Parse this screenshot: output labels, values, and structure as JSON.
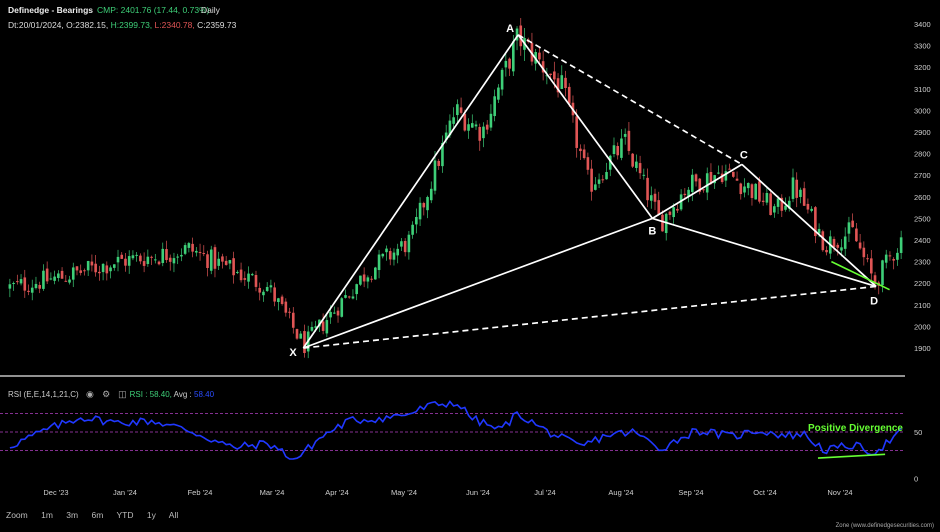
{
  "header": {
    "symbol": "Definedge - Bearings",
    "cmp": "CMP: 2401.76 (17.44, 0.73%)",
    "timeframe": "Daily",
    "date": "Dt:20/01/2024,",
    "open": "O:2382.15,",
    "high": "H:2399.73,",
    "low": "L:2340.78,",
    "close": "C:2359.73"
  },
  "rsi_panel": {
    "label": "RSI (E,E,14,1,21,C)",
    "value": "RSI : 58.40,",
    "avg_label": "Avg :",
    "avg_value": "58.40"
  },
  "zoom": {
    "label": "Zoom",
    "options": [
      "1m",
      "3m",
      "6m",
      "YTD",
      "1y",
      "All"
    ]
  },
  "credit": "Zone (www.definedgesecurities.com)",
  "colors": {
    "up": "#3ecf78",
    "down": "#e05555",
    "rsi_line": "#2038ff",
    "band": "#b040c0",
    "pattern": "#ffffff",
    "divergence": "#66ff33"
  },
  "chart_data": [
    {
      "type": "candlestick",
      "ylim": [
        1800,
        3450
      ],
      "yticks": [
        1900,
        2000,
        2100,
        2200,
        2300,
        2400,
        2500,
        2600,
        2700,
        2800,
        2900,
        3000,
        3100,
        3200,
        3300,
        3400
      ],
      "xticks": [
        "Dec '23",
        "Jan '24",
        "Feb '24",
        "Mar '24",
        "Apr '24",
        "May '24",
        "Jun '24",
        "Jul '24",
        "Aug '24",
        "Sep '24",
        "Oct '24",
        "Nov '24"
      ],
      "trend_anchors": [
        {
          "t": 0,
          "v": 2180
        },
        {
          "t": 0.06,
          "v": 2230
        },
        {
          "t": 0.12,
          "v": 2300
        },
        {
          "t": 0.17,
          "v": 2330
        },
        {
          "t": 0.2,
          "v": 2360
        },
        {
          "t": 0.24,
          "v": 2280
        },
        {
          "t": 0.29,
          "v": 2180
        },
        {
          "t": 0.33,
          "v": 1910
        },
        {
          "t": 0.4,
          "v": 2250
        },
        {
          "t": 0.45,
          "v": 2400
        },
        {
          "t": 0.5,
          "v": 3000
        },
        {
          "t": 0.53,
          "v": 2900
        },
        {
          "t": 0.57,
          "v": 3340
        },
        {
          "t": 0.62,
          "v": 3100
        },
        {
          "t": 0.65,
          "v": 2650
        },
        {
          "t": 0.69,
          "v": 2850
        },
        {
          "t": 0.73,
          "v": 2480
        },
        {
          "t": 0.76,
          "v": 2650
        },
        {
          "t": 0.8,
          "v": 2720
        },
        {
          "t": 0.83,
          "v": 2640
        },
        {
          "t": 0.86,
          "v": 2530
        },
        {
          "t": 0.88,
          "v": 2650
        },
        {
          "t": 0.915,
          "v": 2380
        },
        {
          "t": 0.945,
          "v": 2440
        },
        {
          "t": 0.97,
          "v": 2200
        },
        {
          "t": 1.0,
          "v": 2400
        }
      ],
      "pattern_points": [
        {
          "label": "X",
          "t": 0.33,
          "v": 1900
        },
        {
          "label": "A",
          "t": 0.57,
          "v": 3350
        },
        {
          "label": "B",
          "t": 0.72,
          "v": 2500
        },
        {
          "label": "C",
          "t": 0.82,
          "v": 2750
        },
        {
          "label": "D",
          "t": 0.97,
          "v": 2185
        }
      ],
      "pattern_lines": [
        {
          "from": "X",
          "to": "A",
          "style": "solid"
        },
        {
          "from": "A",
          "to": "B",
          "style": "solid"
        },
        {
          "from": "B",
          "to": "C",
          "style": "solid"
        },
        {
          "from": "C",
          "to": "D",
          "style": "solid"
        },
        {
          "from": "X",
          "to": "B",
          "style": "solid"
        },
        {
          "from": "B",
          "to": "D",
          "style": "solid"
        },
        {
          "from": "X",
          "to": "D",
          "style": "dashed"
        },
        {
          "from": "A",
          "to": "C",
          "style": "dashed"
        }
      ],
      "divergence_line_price": {
        "from": {
          "t": 0.92,
          "v": 2300
        },
        "to": {
          "t": 0.985,
          "v": 2170
        }
      }
    },
    {
      "type": "line",
      "name": "RSI",
      "ylim": [
        0,
        100
      ],
      "yticks": [
        0,
        50
      ],
      "bands": [
        30,
        50,
        70
      ],
      "anchors": [
        {
          "t": 0,
          "v": 35
        },
        {
          "t": 0.04,
          "v": 52
        },
        {
          "t": 0.08,
          "v": 66
        },
        {
          "t": 0.12,
          "v": 60
        },
        {
          "t": 0.16,
          "v": 62
        },
        {
          "t": 0.2,
          "v": 52
        },
        {
          "t": 0.25,
          "v": 33
        },
        {
          "t": 0.29,
          "v": 38
        },
        {
          "t": 0.32,
          "v": 20
        },
        {
          "t": 0.35,
          "v": 45
        },
        {
          "t": 0.38,
          "v": 62
        },
        {
          "t": 0.42,
          "v": 65
        },
        {
          "t": 0.45,
          "v": 70
        },
        {
          "t": 0.47,
          "v": 78
        },
        {
          "t": 0.5,
          "v": 82
        },
        {
          "t": 0.52,
          "v": 64
        },
        {
          "t": 0.55,
          "v": 52
        },
        {
          "t": 0.57,
          "v": 70
        },
        {
          "t": 0.6,
          "v": 52
        },
        {
          "t": 0.64,
          "v": 34
        },
        {
          "t": 0.67,
          "v": 47
        },
        {
          "t": 0.7,
          "v": 50
        },
        {
          "t": 0.73,
          "v": 32
        },
        {
          "t": 0.77,
          "v": 52
        },
        {
          "t": 0.81,
          "v": 45
        },
        {
          "t": 0.84,
          "v": 52
        },
        {
          "t": 0.87,
          "v": 46
        },
        {
          "t": 0.89,
          "v": 48
        },
        {
          "t": 0.915,
          "v": 30
        },
        {
          "t": 0.945,
          "v": 36
        },
        {
          "t": 0.97,
          "v": 28
        },
        {
          "t": 1.0,
          "v": 50
        }
      ],
      "divergence_line": {
        "from": {
          "t": 0.905,
          "v": 22
        },
        "to": {
          "t": 0.98,
          "v": 26
        }
      },
      "annotation": "Positive Divergence"
    }
  ]
}
